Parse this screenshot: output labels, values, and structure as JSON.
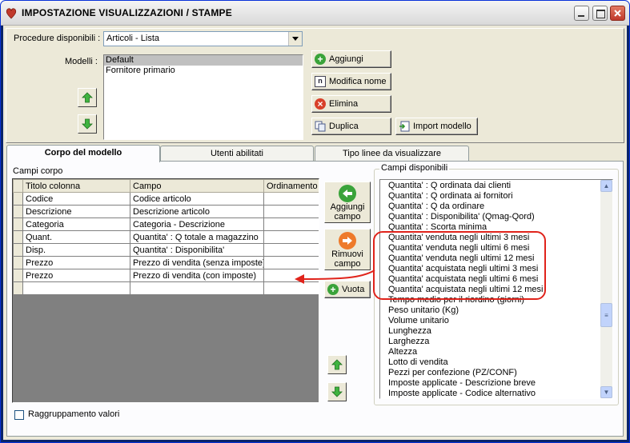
{
  "window": {
    "title": "IMPOSTAZIONE VISUALIZZAZIONI / STAMPE"
  },
  "top": {
    "procedure_label": "Procedure disponibili :",
    "procedure_value": "Articoli - Lista",
    "modelli_label": "Modelli :",
    "modelli": [
      "Default",
      "Fornitore primario"
    ],
    "buttons": {
      "aggiungi": "Aggiungi",
      "modifica_nome": "Modifica nome",
      "elimina": "Elimina",
      "duplica": "Duplica",
      "import_modello": "Import modello"
    }
  },
  "tabs": [
    "Corpo del modello",
    "Utenti abilitati",
    "Tipo linee da visualizzare"
  ],
  "corpo": {
    "campi_corpo_label": "Campi corpo",
    "columns": [
      "Titolo colonna",
      "Campo",
      "Ordinamento"
    ],
    "rows": [
      [
        "Codice",
        "Codice articolo",
        ""
      ],
      [
        "Descrizione",
        "Descrizione articolo",
        ""
      ],
      [
        "Categoria",
        "Categoria - Descrizione",
        ""
      ],
      [
        "Quant.",
        "Quantita' : Q totale a magazzino",
        ""
      ],
      [
        "Disp.",
        "Quantita' : Disponibilita'",
        ""
      ],
      [
        "Prezzo",
        "Prezzo di vendita (senza imposte)",
        ""
      ],
      [
        "Prezzo",
        "Prezzo di vendita (con imposte)",
        ""
      ]
    ],
    "aggiungi_campo": [
      "Aggiungi",
      "campo"
    ],
    "rimuovi_campo": [
      "Rimuovi",
      "campo"
    ],
    "vuota": "Vuota",
    "raggruppamento": "Raggruppamento valori"
  },
  "campi_disponibili": {
    "label": "Campi disponibili",
    "items": [
      "Quantita' : Q ordinata dai clienti",
      "Quantita' : Q ordinata ai fornitori",
      "Quantita' : Q da ordinare",
      "Quantita' : Disponibilita' (Qmag-Qord)",
      "Quantita' : Scorta minima",
      "Quantita' venduta negli ultimi 3 mesi",
      "Quantita' venduta negli ultimi 6 mesi",
      "Quantita' venduta negli ultimi 12 mesi",
      "Quantita' acquistata negli ultimi 3 mesi",
      "Quantita' acquistata negli ultimi 6 mesi",
      "Quantita' acquistata negli ultimi 12 mesi",
      "Tempo medio per il riordino (giorni)",
      "Peso unitario (Kg)",
      "Volume unitario",
      "Lunghezza",
      "Larghezza",
      "Altezza",
      "Lotto di vendita",
      "Pezzi per confezione (PZ/CONF)",
      "Imposte applicate - Descrizione breve",
      "Imposte applicate - Codice alternativo"
    ]
  },
  "colors": {
    "highlight": "#e0231b",
    "title_bar": "#e5e5e5"
  }
}
